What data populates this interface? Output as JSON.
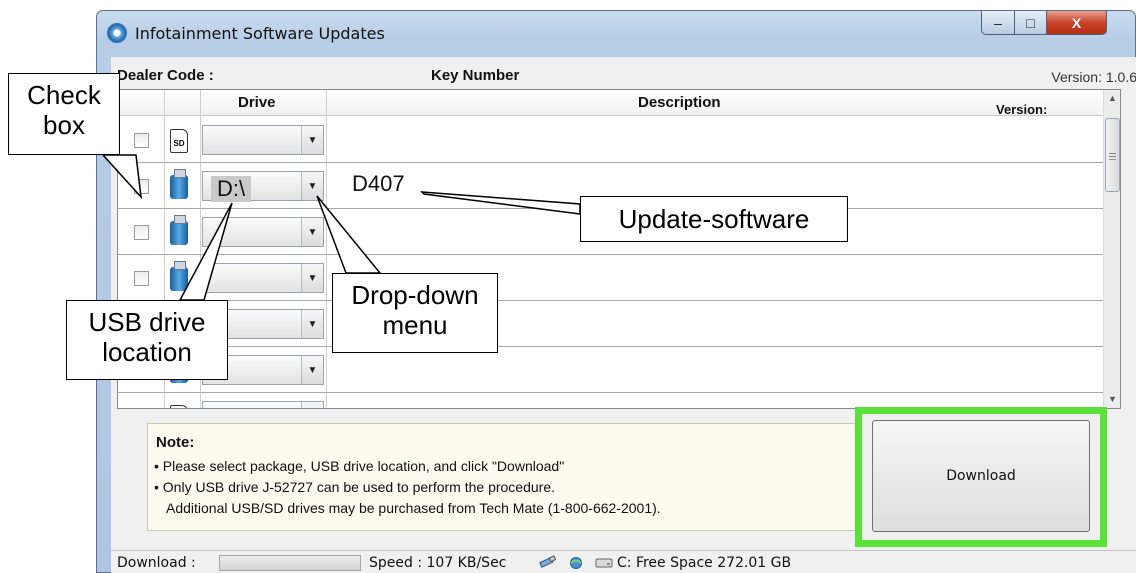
{
  "window": {
    "title": "Infotainment Software Updates",
    "buttons": {
      "minimize": "–",
      "maximize": "□",
      "close": "X"
    }
  },
  "header": {
    "dealer_code_label": "Dealer Code :",
    "key_number_label": "Key Number",
    "version_label": "Version: 1.0.6"
  },
  "grid": {
    "columns": {
      "drive": "Drive",
      "description": "Description",
      "version": "Version:"
    },
    "rows": [
      {
        "device": "sd",
        "device_label": "SD",
        "drive": "",
        "description": ""
      },
      {
        "device": "usb",
        "drive": "D:\\",
        "description": "D407"
      },
      {
        "device": "usb",
        "drive": "",
        "description": ""
      },
      {
        "device": "usb",
        "drive": "",
        "description": ""
      },
      {
        "device": "usb",
        "drive": "",
        "description": ""
      },
      {
        "device": "usb",
        "drive": "",
        "description": ""
      },
      {
        "device": "sd",
        "drive": "",
        "description": ""
      }
    ]
  },
  "note": {
    "title": "Note:",
    "lines": [
      "• Please select package, USB drive location, and click \"Download\"",
      "• Only USB drive J-52727 can be used to perform the procedure.",
      "Additional USB/SD drives may be purchased from Tech Mate (1-800-662-2001)."
    ]
  },
  "download_button": "Download",
  "status_bar": {
    "download_label": "Download :",
    "speed": "Speed : 107 KB/Sec",
    "free_space": "C: Free Space 272.01 GB"
  },
  "callouts": {
    "check_box": [
      "Check",
      "box"
    ],
    "update_software": "Update-software",
    "drop_down": [
      "Drop-down",
      "menu"
    ],
    "usb_drive": [
      "USB drive",
      "location"
    ]
  },
  "colors": {
    "highlight": "#5ce03a",
    "close_button": "#c9432a"
  }
}
